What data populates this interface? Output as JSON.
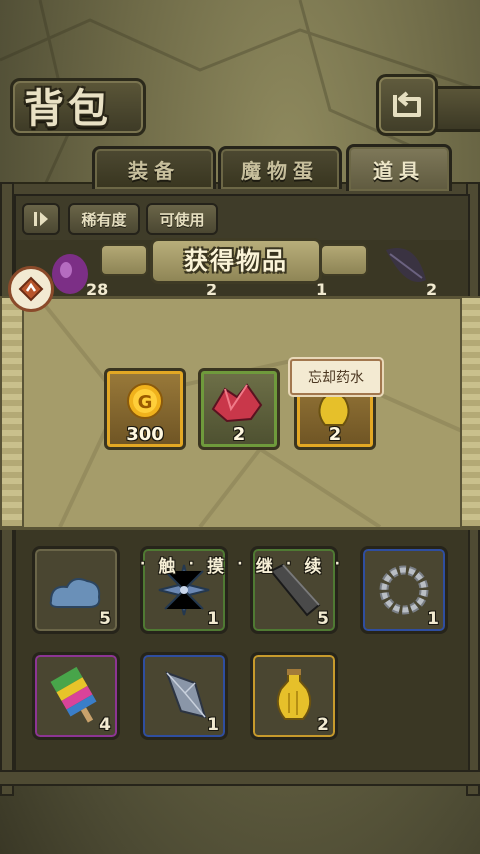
{
  "header": {
    "title": "背包",
    "back_icon": "return-arrow-icon"
  },
  "tabs": [
    {
      "label": "装备",
      "active": false
    },
    {
      "label": "魔物蛋",
      "active": false
    },
    {
      "label": "道具",
      "active": true
    }
  ],
  "filters": {
    "sort_icon": "sort-toggle-icon",
    "rarity_label": "稀有度",
    "usable_label": "可使用"
  },
  "peek_row": [
    {
      "icon": "purple-potion-icon",
      "count": "28"
    },
    {
      "icon": "red-crystal-icon",
      "count": "2"
    },
    {
      "icon": "dark-star-icon",
      "count": "1"
    },
    {
      "icon": "dark-leaf-icon",
      "count": "2"
    }
  ],
  "popup": {
    "title": "获得物品",
    "rewards": [
      {
        "icon": "gold-coin-icon",
        "count": "300",
        "rarity_color": "#e3a824"
      },
      {
        "icon": "red-crystal-icon",
        "count": "2",
        "rarity_color": "#6f9a3c"
      },
      {
        "icon": "yellow-potion-icon",
        "count": "2",
        "rarity_color": "#e3a824"
      }
    ],
    "tooltip": "忘却药水",
    "coin_letter": "G",
    "hint_chars": [
      "触",
      "摸",
      "继",
      "续"
    ],
    "hint_dot": "·"
  },
  "inventory": [
    {
      "icon": "blue-cloud-icon",
      "count": "5",
      "rim": "#6b6649"
    },
    {
      "icon": "blue-flower-icon",
      "count": "1",
      "rim": "#4f7a33"
    },
    {
      "icon": "stone-bar-icon",
      "count": "5",
      "rim": "#4f7a33"
    },
    {
      "icon": "pearl-necklace-icon",
      "count": "1",
      "rim": "#2f4ea0"
    },
    {
      "icon": "rainbow-popsicle-icon",
      "count": "4",
      "rim": "#8d3594"
    },
    {
      "icon": "crystal-shard-icon",
      "count": "1",
      "rim": "#2f4ea0"
    },
    {
      "icon": "yellow-potion-icon",
      "count": "2",
      "rim": "#c79a2c"
    }
  ]
}
